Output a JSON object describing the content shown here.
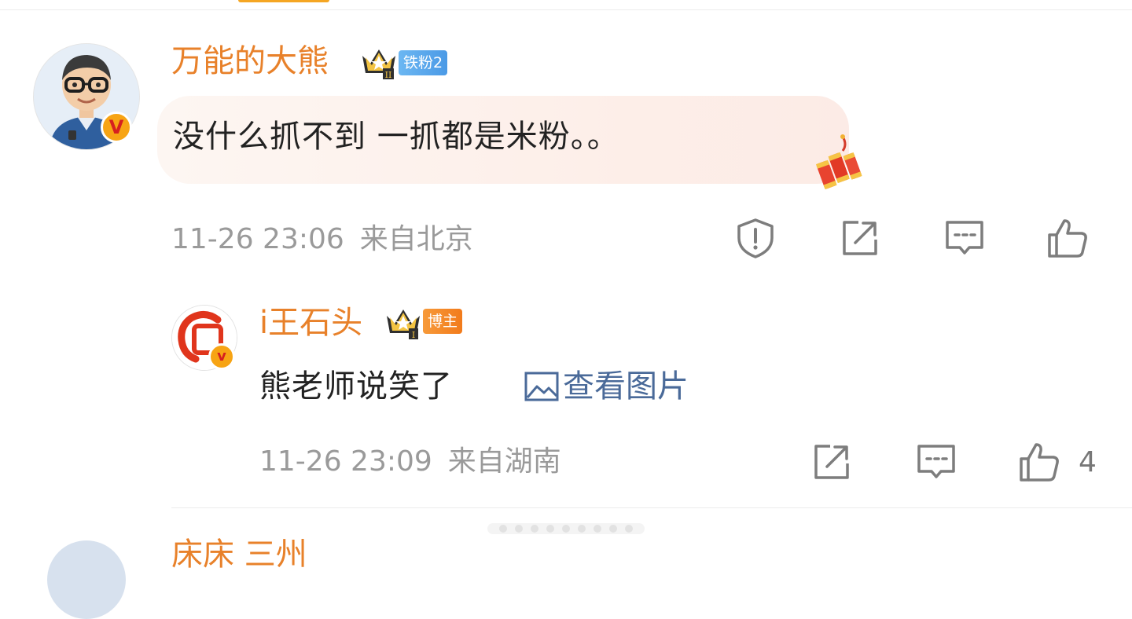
{
  "comment": {
    "username": "万能的大熊",
    "fan_tag": "铁粉2",
    "content": "没什么抓不到 一抓都是米粉。。",
    "time": "11-26 23:06",
    "location": "来自北京",
    "verified_badge": "V",
    "sticker": "firecracker-sticker",
    "actions": [
      "report-icon",
      "share-icon",
      "reply-icon",
      "like-icon"
    ]
  },
  "reply": {
    "username": "i王石头",
    "role_tag": "博主",
    "content": "熊老师说笑了",
    "view_image_label": "查看图片",
    "time": "11-26 23:09",
    "location": "来自湖南",
    "verified_badge": "v",
    "like_count": "4",
    "actions": [
      "share-icon",
      "reply-icon",
      "like-icon"
    ]
  },
  "next_comment": {
    "username_partial": "床床 三州"
  },
  "colors": {
    "username": "#e8812a",
    "fan_tag_bg": "#5aa8ec",
    "role_tag_bg": "#f5891f",
    "meta_text": "#9a9a9a",
    "link": "#4a6a99",
    "badge": "#f7a414"
  }
}
